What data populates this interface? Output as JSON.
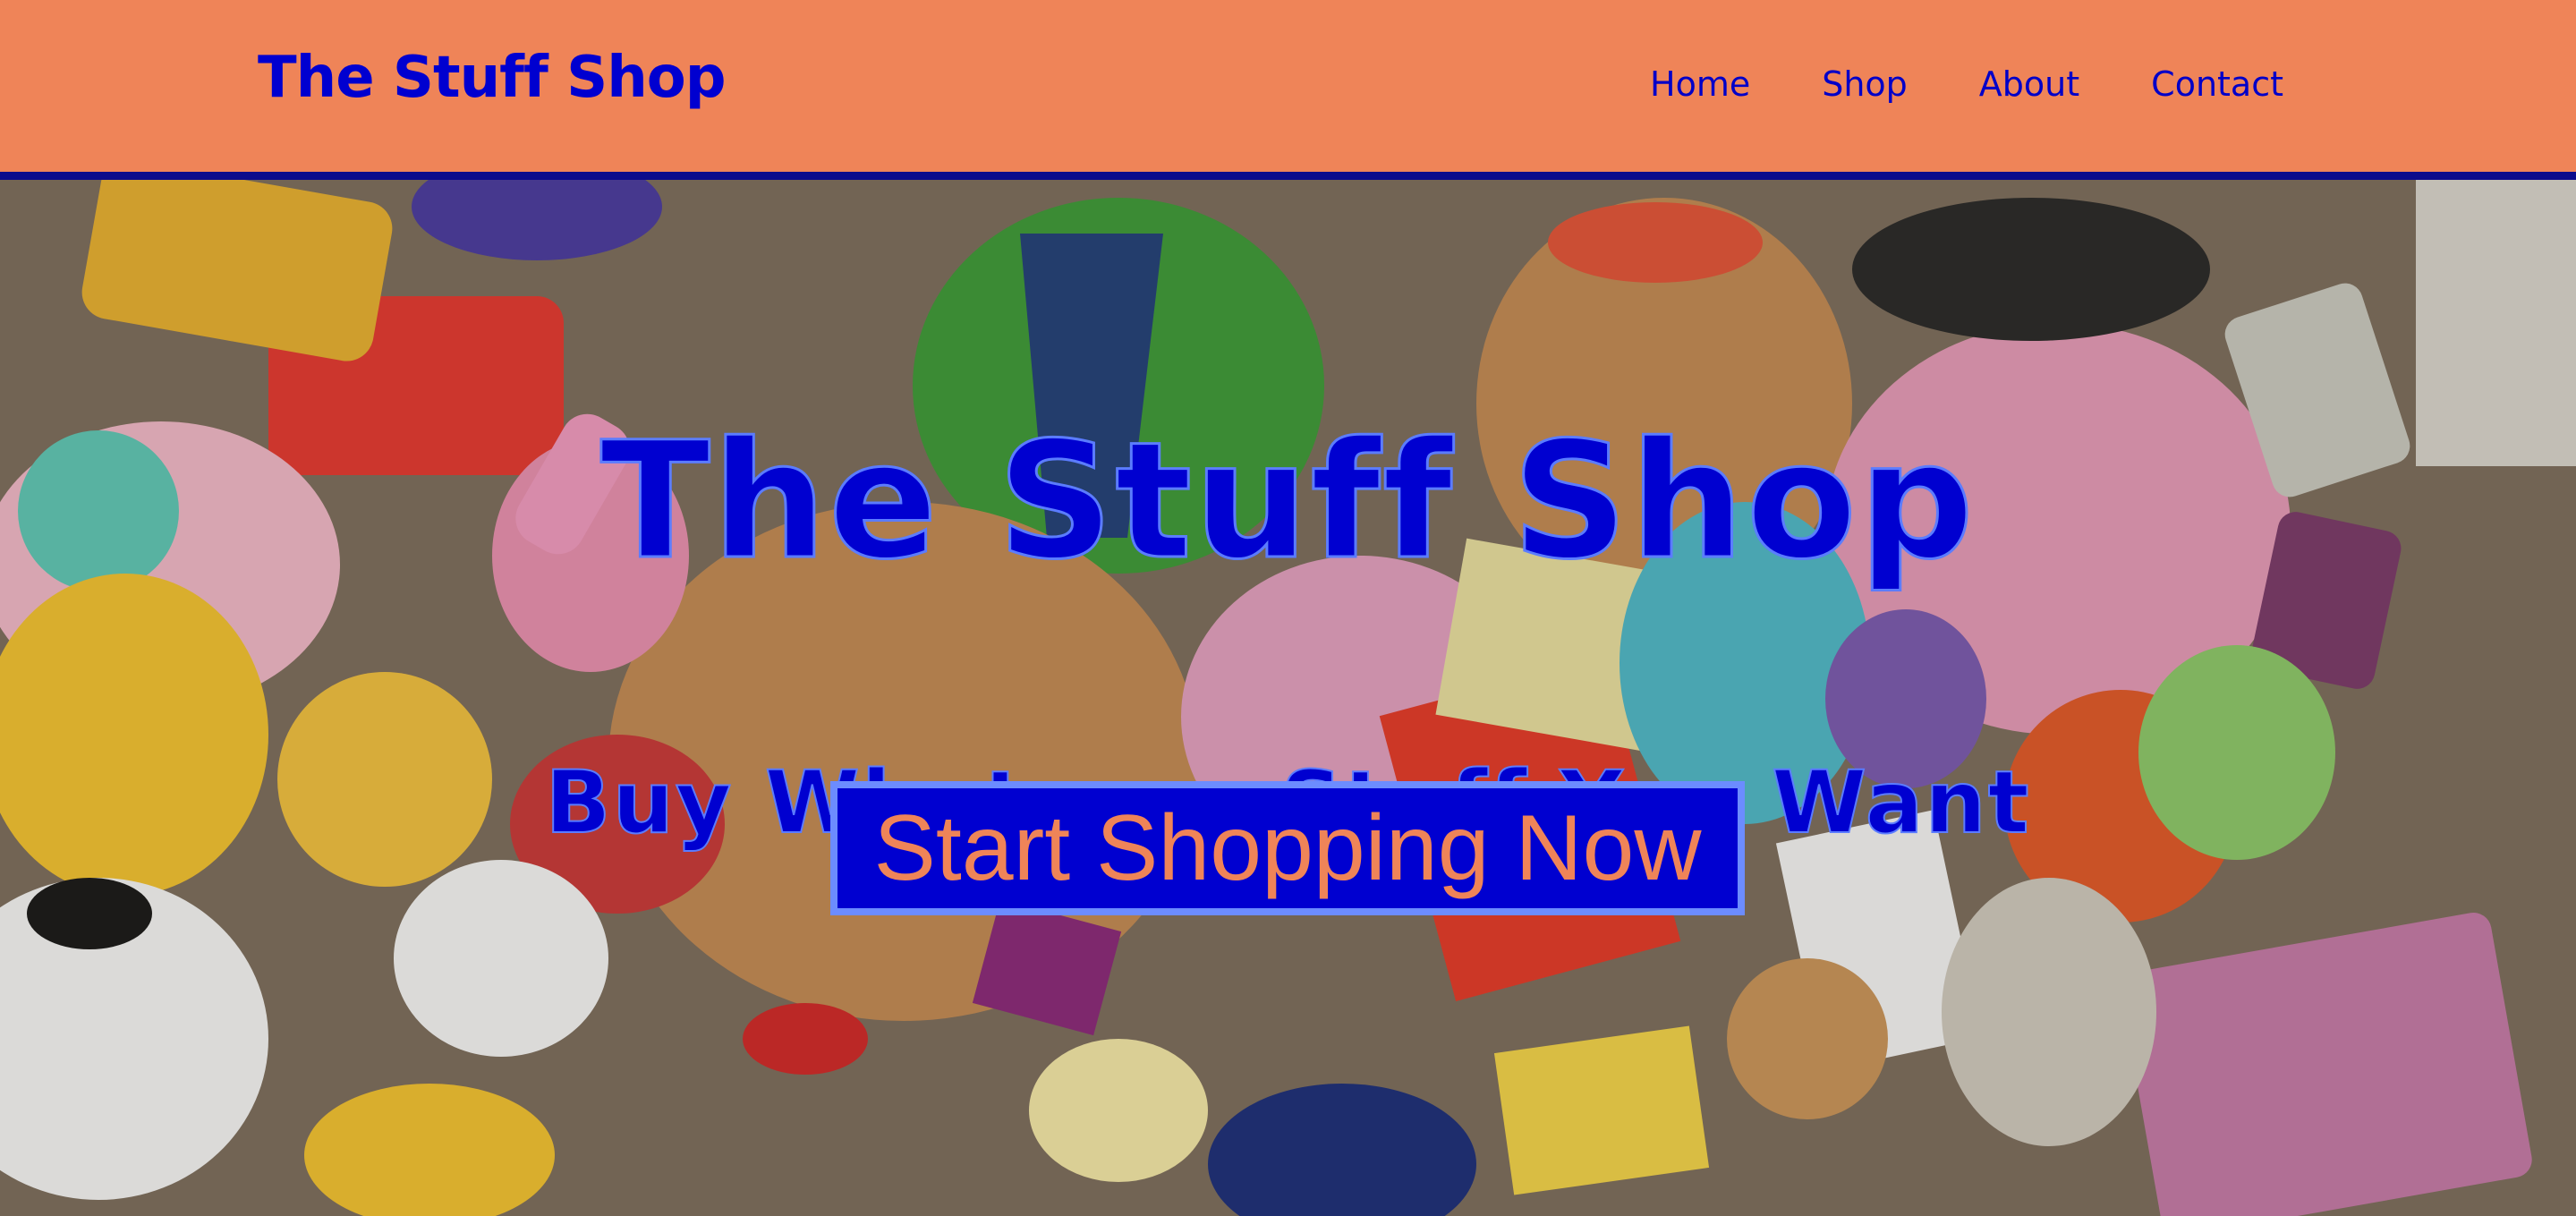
{
  "header": {
    "logo": "The Stuff Shop",
    "nav": [
      "Home",
      "Shop",
      "About",
      "Contact"
    ]
  },
  "hero": {
    "title": "The Stuff Shop",
    "subtitle": "Buy Whatever Stuff You Want",
    "cta_label": "Start Shopping Now",
    "background_image": "pile of assorted children's toys"
  },
  "colors": {
    "header_bg": "#ef8458",
    "header_border": "#0c0c8c",
    "brand_blue": "#0000d0",
    "outline_blue": "#5b7cff",
    "cta_text": "#ef8458"
  }
}
